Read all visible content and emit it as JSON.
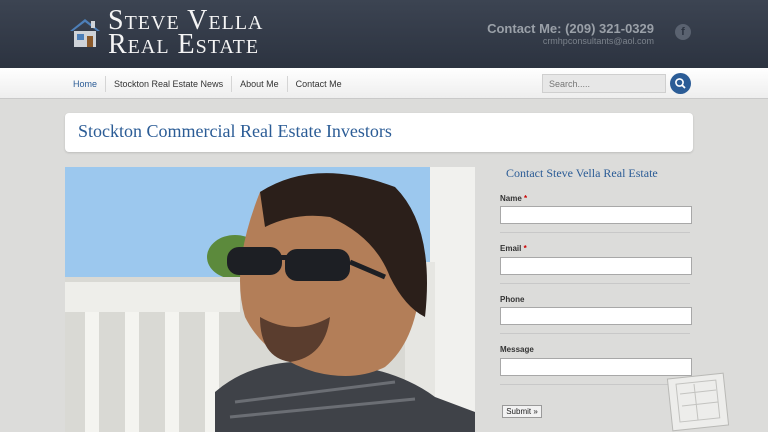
{
  "header": {
    "logo_line1": "Steve Vella",
    "logo_line2": "Real Estate",
    "contact_phone": "Contact Me: (209) 321-0329",
    "contact_email": "crmhpconsultants@aol.com",
    "facebook_glyph": "f"
  },
  "nav": {
    "items": [
      "Home",
      "Stockton Real Estate News",
      "About Me",
      "Contact Me"
    ],
    "active": "Home",
    "search_placeholder": "Search....."
  },
  "page": {
    "title": "Stockton Commercial Real Estate Investors"
  },
  "contact_form": {
    "title": "Contact Steve Vella Real Estate",
    "fields": [
      {
        "label": "Name",
        "required_mark": "*"
      },
      {
        "label": "Email",
        "required_mark": "*"
      },
      {
        "label": "Phone",
        "required_mark": ""
      },
      {
        "label": "Message",
        "required_mark": ""
      }
    ],
    "submit_label": "Submit »"
  },
  "colors": {
    "brand_blue": "#2b5c96",
    "header_bg": "#333a47",
    "page_bg": "#dcdcda"
  },
  "icons": [
    "house-logo-icon",
    "facebook-icon",
    "search-icon"
  ]
}
